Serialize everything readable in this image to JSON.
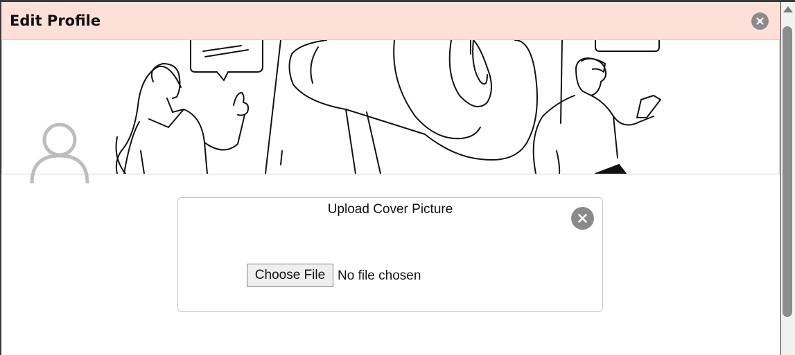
{
  "modal": {
    "title": "Edit Profile",
    "close_icon": "close-icon"
  },
  "cover": {
    "illustration": "megaphone-marketing-illustration",
    "avatar_icon": "user-avatar-icon"
  },
  "upload": {
    "title": "Upload Cover Picture",
    "close_icon": "close-icon",
    "choose_file_label": "Choose File",
    "file_status": "No file chosen"
  },
  "colors": {
    "header_bg": "#fde0d8",
    "close_bg": "#8a8a8a",
    "button_bg": "#efefef"
  }
}
